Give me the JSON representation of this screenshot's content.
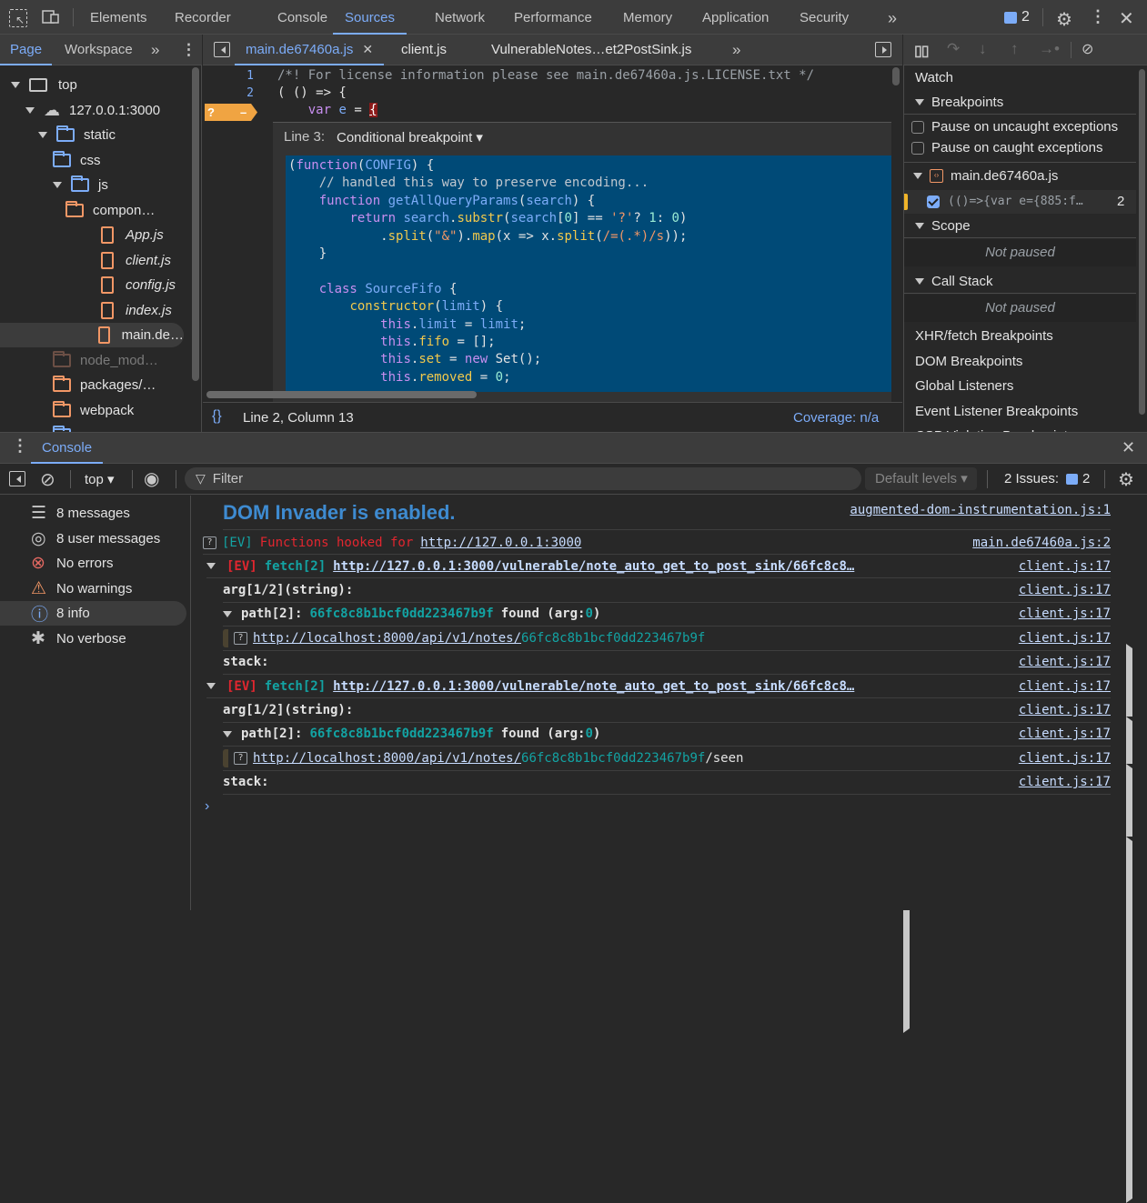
{
  "toolbar": {
    "tabs": [
      "Elements",
      "Recorder",
      "Console",
      "Sources",
      "Network",
      "Performance",
      "Memory",
      "Application",
      "Security"
    ],
    "active_tab": "Sources",
    "more_tabs": "»",
    "issues_count": "2"
  },
  "navigator": {
    "tabs": [
      "Page",
      "Workspace"
    ],
    "active_tab": "Page",
    "tree": [
      {
        "label": "top",
        "depth": 0,
        "icon": "frame-icon",
        "expanded": true
      },
      {
        "label": "127.0.0.1:3000",
        "depth": 1,
        "icon": "cloud-icon",
        "expanded": true
      },
      {
        "label": "static",
        "depth": 2,
        "icon": "folder-icon",
        "expanded": true
      },
      {
        "label": "css",
        "depth": 3,
        "icon": "folder-icon",
        "expanded": false
      },
      {
        "label": "js",
        "depth": 3,
        "icon": "folder-icon",
        "expanded": true
      },
      {
        "label": "compon…",
        "depth": 4,
        "icon": "folder-icon",
        "expanded": false
      },
      {
        "label": "App.js",
        "depth": 5,
        "icon": "file-icon"
      },
      {
        "label": "client.js",
        "depth": 5,
        "icon": "file-icon"
      },
      {
        "label": "config.js",
        "depth": 5,
        "icon": "file-icon"
      },
      {
        "label": "index.js",
        "depth": 5,
        "icon": "file-icon"
      },
      {
        "label": "main.de…",
        "depth": 5,
        "icon": "file-icon",
        "selected": true
      },
      {
        "label": "node_mod…",
        "depth": 3,
        "icon": "folder-icon",
        "expanded": false
      },
      {
        "label": "packages/…",
        "depth": 3,
        "icon": "folder-icon",
        "expanded": false
      },
      {
        "label": "webpack",
        "depth": 3,
        "icon": "folder-icon",
        "expanded": false
      }
    ]
  },
  "editor": {
    "tabs": [
      "main.de67460a.js",
      "client.js",
      "VulnerableNotes…et2PostSink.js"
    ],
    "active_tab": "main.de67460a.js",
    "lines": [
      {
        "n": "1",
        "text": "/*! For license information please see main.de67460a.js.LICENSE.txt */"
      },
      {
        "n": "2",
        "text": "( () => {"
      },
      {
        "n": "",
        "text": "    var e = {"
      }
    ],
    "breakpoint_marker": "?",
    "breakpoint_editor": {
      "line_label": "Line 3:",
      "type_label": "Conditional breakpoint ▾",
      "code": [
        "(function(CONFIG) {",
        "    // handled this way to preserve encoding...",
        "    function getAllQueryParams(search) {",
        "        return search.substr(search[0] == '?'? 1: 0)",
        "            .split(\"&\").map(x => x.split(/=(.*)/s));",
        "    }",
        "",
        "    class SourceFifo {",
        "        constructor(limit) {",
        "            this.limit = limit;",
        "            this.fifo = [];",
        "            this.set = new Set();",
        "            this.removed = 0;"
      ]
    },
    "status": {
      "position": "Line 2, Column 13",
      "coverage": "Coverage: n/a"
    }
  },
  "debugger": {
    "watch": "Watch",
    "breakpoints": "Breakpoints",
    "pause_uncaught": "Pause on uncaught exceptions",
    "pause_caught": "Pause on caught exceptions",
    "bp_file": "main.de67460a.js",
    "bp_entry": "(()=>{var e={885:f…",
    "bp_line": "2",
    "scope": "Scope",
    "scope_state": "Not paused",
    "callstack": "Call Stack",
    "callstack_state": "Not paused",
    "sections": [
      "XHR/fetch Breakpoints",
      "DOM Breakpoints",
      "Global Listeners",
      "Event Listener Breakpoints",
      "CSP Violation Breakpoints"
    ]
  },
  "drawer": {
    "tab": "Console",
    "context": "top ▾",
    "filter_placeholder": "Filter",
    "levels": "Default levels ▾",
    "issues_label": "2 Issues:",
    "issues_count": "2"
  },
  "console_sidebar": [
    {
      "label": "8 messages",
      "icon": "list-icon",
      "expandable": true
    },
    {
      "label": "8 user messages",
      "icon": "user-icon",
      "expandable": true
    },
    {
      "label": "No errors",
      "icon": "error-icon",
      "expandable": false
    },
    {
      "label": "No warnings",
      "icon": "warning-icon",
      "expandable": false
    },
    {
      "label": "8 info",
      "icon": "info-icon",
      "expandable": true,
      "selected": true
    },
    {
      "label": "No verbose",
      "icon": "bug-icon",
      "expandable": false
    }
  ],
  "console": {
    "banner": "DOM Invader is enabled.",
    "banner_src": "augmented-dom-instrumentation.js:1",
    "hooked": {
      "tag": "[EV]",
      "text": "Functions hooked for",
      "url": "http://127.0.0.1:3000",
      "src": "main.de67460a.js:2"
    },
    "groups": [
      {
        "tag": "[EV]",
        "fn": "fetch[2]",
        "url": "http://127.0.0.1:3000/vulnerable/note_auto_get_to_post_sink/66fc8c8…",
        "src": "client.js:17",
        "arg": "arg[1/2](string):",
        "path_label": "path[2]:",
        "path_value": "66fc8c8b1bcf0dd223467b9f",
        "found": "found (arg:",
        "arg_index": "0",
        "close": ")",
        "link_base": "http://localhost:8000/api/v1/notes/",
        "link_id": "66fc8c8b1bcf0dd223467b9f",
        "link_suffix": "",
        "stack": "stack:"
      },
      {
        "tag": "[EV]",
        "fn": "fetch[2]",
        "url": "http://127.0.0.1:3000/vulnerable/note_auto_get_to_post_sink/66fc8c8…",
        "src": "client.js:17",
        "arg": "arg[1/2](string):",
        "path_label": "path[2]:",
        "path_value": "66fc8c8b1bcf0dd223467b9f",
        "found": "found (arg:",
        "arg_index": "0",
        "close": ")",
        "link_base": "http://localhost:8000/api/v1/notes/",
        "link_id": "66fc8c8b1bcf0dd223467b9f",
        "link_suffix": "/seen",
        "stack": "stack:"
      }
    ],
    "prompt": "›"
  },
  "colors": {
    "accent": "#7cacf8",
    "breakpoint": "#f0a442",
    "cb_bg": "#004a77",
    "ev_red": "#e2262f",
    "teal": "#13a3a3",
    "banner": "#3e8bd1"
  }
}
